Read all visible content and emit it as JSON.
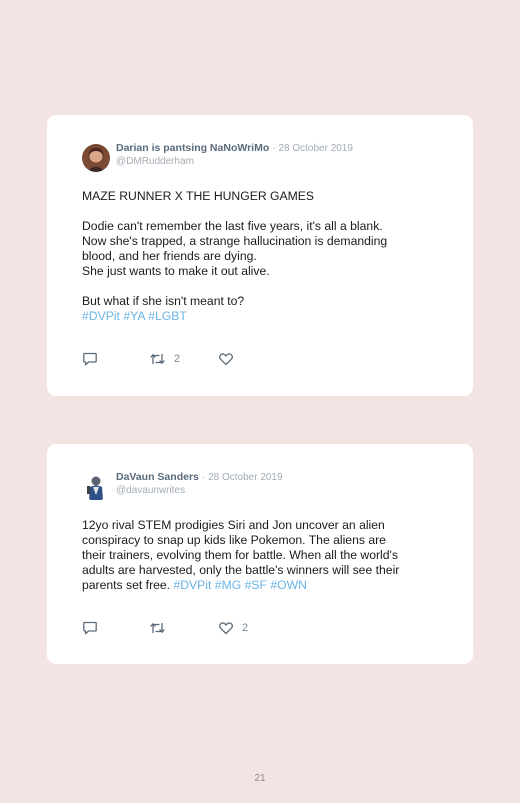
{
  "tweets": [
    {
      "display_name": "Darian is pantsing NaNoWriMo",
      "separator": "·",
      "date": "28 October 2019",
      "handle": "@DMRudderham",
      "body": {
        "p1": "MAZE RUNNER X THE HUNGER GAMES",
        "p2_l1": "Dodie can't remember the last five years, it's all a blank.",
        "p2_l2": "Now she's trapped, a strange hallucination is demanding",
        "p2_l3": "blood, and her friends are dying.",
        "p2_l4": "She just wants to make it out alive.",
        "p3_l1": "But what if she isn't meant to?",
        "tags": [
          "#DVPit",
          "#YA",
          "#LGBT"
        ]
      },
      "actions": {
        "reply_icon": "reply-icon",
        "retweet_icon": "retweet-icon",
        "retweet_count": "2",
        "like_icon": "heart-icon",
        "like_count": ""
      }
    },
    {
      "display_name": "DaVaun Sanders",
      "separator": "·",
      "date": "28 October 2019",
      "handle": "@davaunwrites",
      "body": {
        "l1": "12yo rival STEM prodigies Siri and Jon uncover an alien",
        "l2": "conspiracy to snap up kids like Pokemon. The aliens are",
        "l3": "their trainers, evolving them for battle. When all the world's",
        "l4": "adults are harvested, only the battle's winners will see their",
        "l5": "parents set free.",
        "tags": [
          "#DVPit",
          "#MG",
          "#SF",
          "#OWN"
        ]
      },
      "actions": {
        "reply_icon": "reply-icon",
        "retweet_icon": "retweet-icon",
        "retweet_count": "",
        "like_icon": "heart-icon",
        "like_count": "2"
      }
    }
  ],
  "colors": {
    "page_background": "#f4e3e3",
    "card_background": "#ffffff",
    "hashtag": "#6ab4e6",
    "meta_text": "#a3acb5",
    "body_text": "#1b1b1b"
  },
  "page_number": "21"
}
